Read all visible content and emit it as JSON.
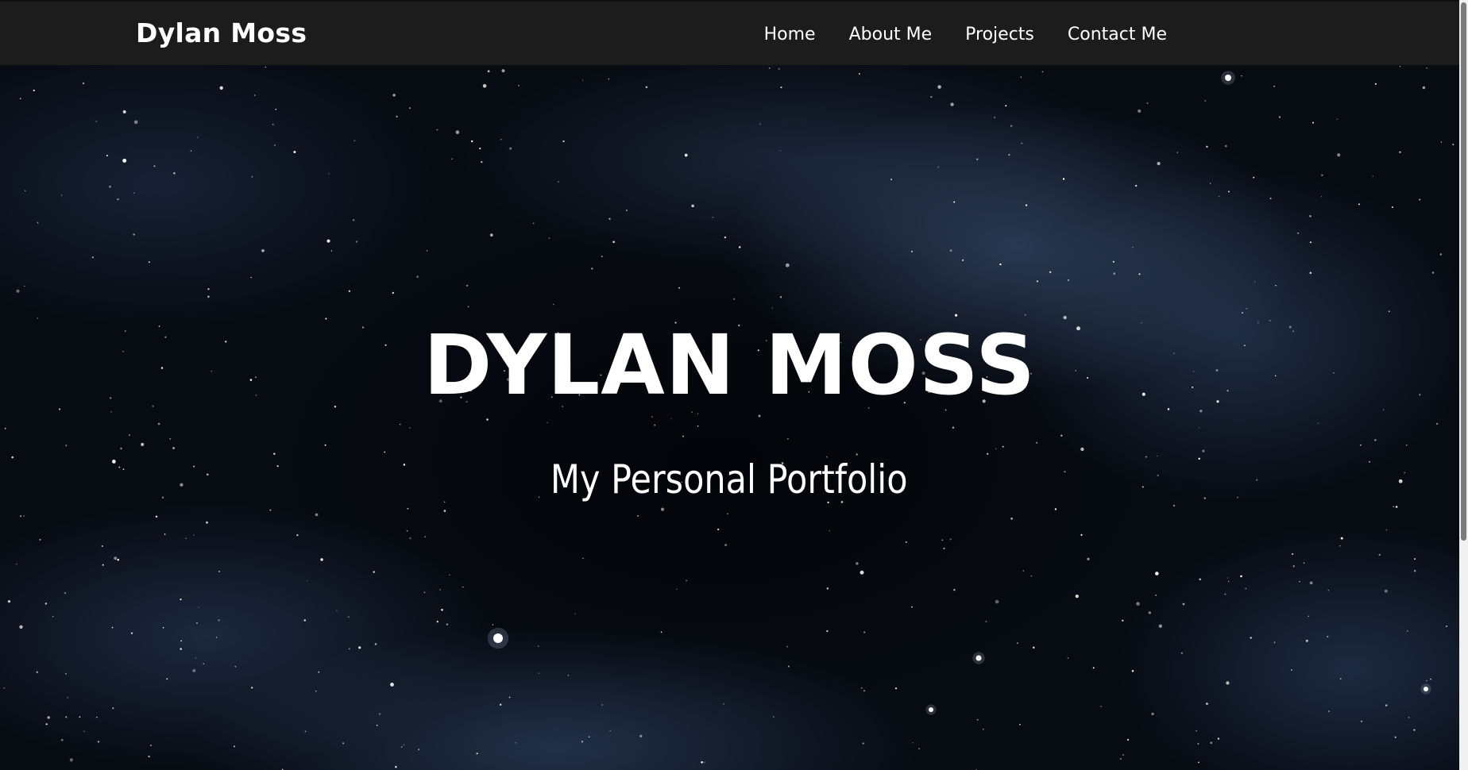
{
  "navbar": {
    "brand": "Dylan Moss",
    "links": [
      {
        "label": "Home"
      },
      {
        "label": "About Me"
      },
      {
        "label": "Projects"
      },
      {
        "label": "Contact Me"
      }
    ]
  },
  "hero": {
    "title": "DYLAN MOSS",
    "subtitle": "My Personal Portfolio"
  },
  "colors": {
    "navbar_bg": "#1c1c1c",
    "text": "#ffffff",
    "sky": "#070b12"
  }
}
